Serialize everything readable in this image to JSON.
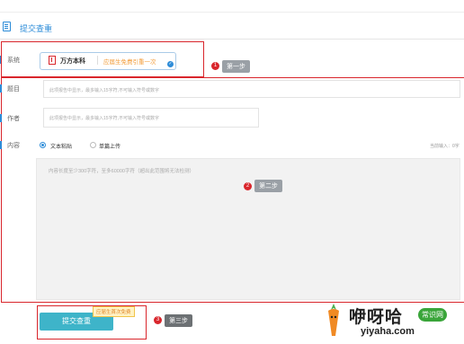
{
  "header": {
    "title": "提交查重"
  },
  "rows": {
    "system": {
      "label": "系统"
    },
    "title": {
      "label": "题目",
      "placeholder": "此项报告中显示，最多输入15字符,不可输入符号或数字"
    },
    "author": {
      "label": "作者",
      "placeholder": "此项报告中显示，最多输入15字符,不可输入符号或数字"
    },
    "content": {
      "label": "内容"
    }
  },
  "system_card": {
    "name": "万方本科",
    "promo": "应届生免费引重一次"
  },
  "content_options": [
    {
      "label": "文本粘贴",
      "selected": true
    },
    {
      "label": "单篇上传",
      "selected": false
    }
  ],
  "content_count": "当前输入：0字",
  "textarea_placeholder": "内容长度至少300字符，至多60000字符（超出此范围将无法检测）",
  "steps": [
    {
      "num": "1",
      "label": "第一步"
    },
    {
      "num": "2",
      "label": "第二步"
    },
    {
      "num": "3",
      "label": "第三步"
    }
  ],
  "submit": {
    "label": "提交查重",
    "promo": "应届生首次免费"
  },
  "watermark": {
    "brand": "咿呀哈",
    "badge": "常识网",
    "url": "yiyaha.com"
  }
}
